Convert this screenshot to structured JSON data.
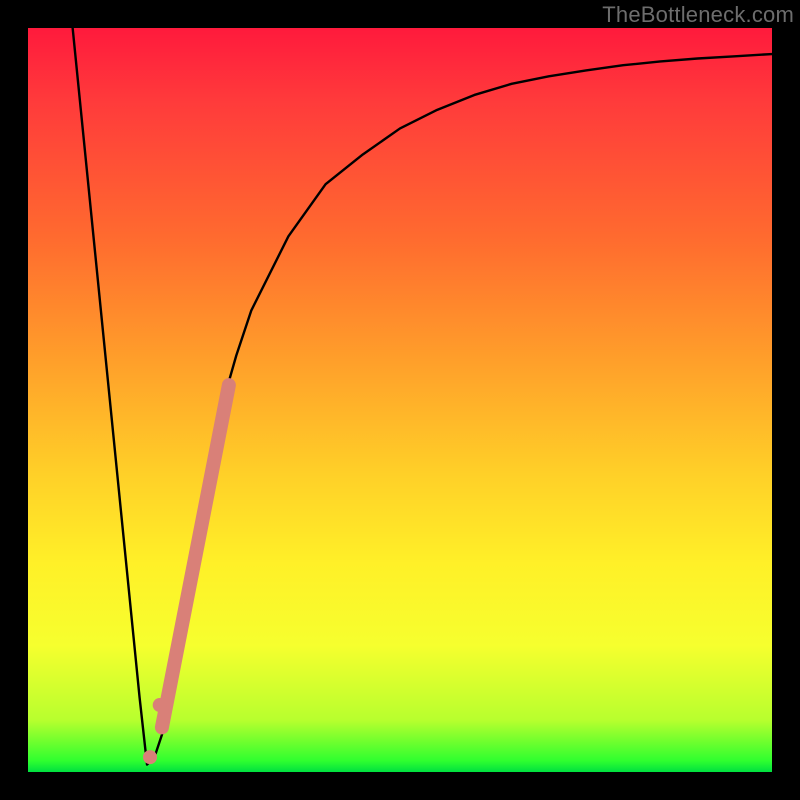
{
  "watermark": "TheBottleneck.com",
  "colors": {
    "background": "#000000",
    "gradient_top": "#ff1a3c",
    "gradient_mid": "#fff028",
    "gradient_bottom": "#00e040",
    "curve": "#000000",
    "marker": "#d98078"
  },
  "chart_data": {
    "type": "line",
    "title": "",
    "xlabel": "",
    "ylabel": "",
    "xlim": [
      0,
      100
    ],
    "ylim": [
      0,
      100
    ],
    "series": [
      {
        "name": "bottleneck-curve",
        "x": [
          6,
          7,
          8,
          9,
          10,
          11,
          12,
          13,
          14,
          15,
          16,
          17,
          18,
          19,
          20,
          22,
          24,
          26,
          28,
          30,
          35,
          40,
          45,
          50,
          55,
          60,
          65,
          70,
          75,
          80,
          85,
          90,
          95,
          100
        ],
        "y": [
          100,
          90,
          80,
          70,
          60,
          50,
          40,
          30,
          20,
          10,
          1,
          2,
          5,
          11,
          18,
          30,
          40,
          49,
          56,
          62,
          72,
          79,
          83,
          86.5,
          89,
          91,
          92.5,
          93.5,
          94.3,
          95,
          95.5,
          95.9,
          96.2,
          96.5
        ]
      }
    ],
    "annotations": [
      {
        "name": "salmon-segment",
        "type": "line-segment",
        "x0": 18,
        "y0": 6,
        "x1": 27,
        "y1": 52
      },
      {
        "name": "salmon-dot-1",
        "type": "point",
        "x": 17.7,
        "y": 9
      },
      {
        "name": "salmon-dot-2",
        "type": "point",
        "x": 16.4,
        "y": 2
      }
    ]
  }
}
